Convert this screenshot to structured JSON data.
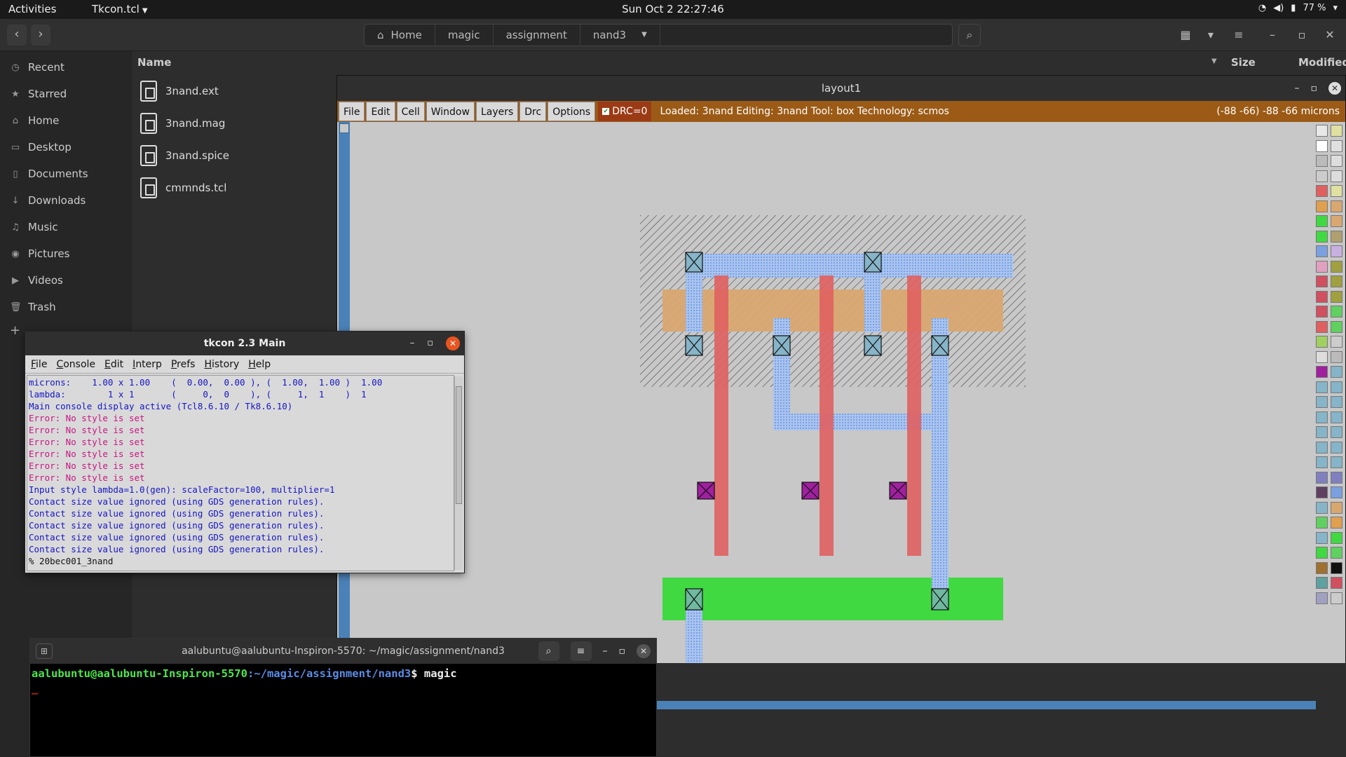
{
  "topbar": {
    "activities": "Activities",
    "app_name": "Tkcon.tcl",
    "clock": "Sun Oct 2  22:27:46",
    "battery": "77 %"
  },
  "file_manager": {
    "breadcrumbs": [
      "Home",
      "magic",
      "assignment",
      "nand3"
    ],
    "sidebar": [
      {
        "label": "Recent",
        "icon": "clock-icon"
      },
      {
        "label": "Starred",
        "icon": "star-icon"
      },
      {
        "label": "Home",
        "icon": "home-icon"
      },
      {
        "label": "Desktop",
        "icon": "desktop-icon"
      },
      {
        "label": "Documents",
        "icon": "document-icon"
      },
      {
        "label": "Downloads",
        "icon": "download-icon"
      },
      {
        "label": "Music",
        "icon": "music-icon"
      },
      {
        "label": "Pictures",
        "icon": "camera-icon"
      },
      {
        "label": "Videos",
        "icon": "video-icon"
      },
      {
        "label": "Trash",
        "icon": "trash-icon"
      }
    ],
    "columns": {
      "name": "Name",
      "size": "Size",
      "modified": "Modified"
    },
    "files": [
      "3nand.ext",
      "3nand.mag",
      "3nand.spice",
      "cmmnds.tcl"
    ]
  },
  "magic_window": {
    "title": "layout1",
    "menu": [
      "File",
      "Edit",
      "Cell",
      "Window",
      "Layers",
      "Drc",
      "Options"
    ],
    "drc": "DRC=0",
    "status": "Loaded: 3nand Editing: 3nand Tool: box  Technology: scmos",
    "coords": "(-88 -66) -88 -66 microns"
  },
  "tkcon": {
    "title": "tkcon 2.3 Main",
    "menu": [
      "File",
      "Console",
      "Edit",
      "Interp",
      "Prefs",
      "History",
      "Help"
    ],
    "lines": [
      {
        "text": "microns:    1.00 x 1.00    (  0.00,  0.00 ), (  1.00,  1.00 )  1.00",
        "kind": "blue"
      },
      {
        "text": "lambda:        1 x 1       (     0,  0    ), (     1,  1    )  1",
        "kind": "blue"
      },
      {
        "text": "Main console display active (Tcl8.6.10 / Tk8.6.10)",
        "kind": "blue"
      },
      {
        "text": "Error: No style is set",
        "kind": "red"
      },
      {
        "text": "Error: No style is set",
        "kind": "red"
      },
      {
        "text": "Error: No style is set",
        "kind": "red"
      },
      {
        "text": "Error: No style is set",
        "kind": "red"
      },
      {
        "text": "Error: No style is set",
        "kind": "red"
      },
      {
        "text": "Error: No style is set",
        "kind": "red"
      },
      {
        "text": "Input style lambda=1.0(gen): scaleFactor=100, multiplier=1",
        "kind": "blue"
      },
      {
        "text": "Contact size value ignored (using GDS generation rules).",
        "kind": "blue"
      },
      {
        "text": "Contact size value ignored (using GDS generation rules).",
        "kind": "blue"
      },
      {
        "text": "Contact size value ignored (using GDS generation rules).",
        "kind": "blue"
      },
      {
        "text": "Contact size value ignored (using GDS generation rules).",
        "kind": "blue"
      },
      {
        "text": "Contact size value ignored (using GDS generation rules).",
        "kind": "blue"
      },
      {
        "text": "% 20bec001_3nand",
        "kind": "blk"
      }
    ]
  },
  "terminal": {
    "title": "aalubuntu@aalubuntu-Inspiron-5570: ~/magic/assignment/nand3",
    "prompt_user": "aalubuntu@aalubuntu-Inspiron-5570",
    "prompt_path": ":~/magic/assignment/nand3",
    "prompt_cmd": "$ magic",
    "cursor": "_"
  }
}
